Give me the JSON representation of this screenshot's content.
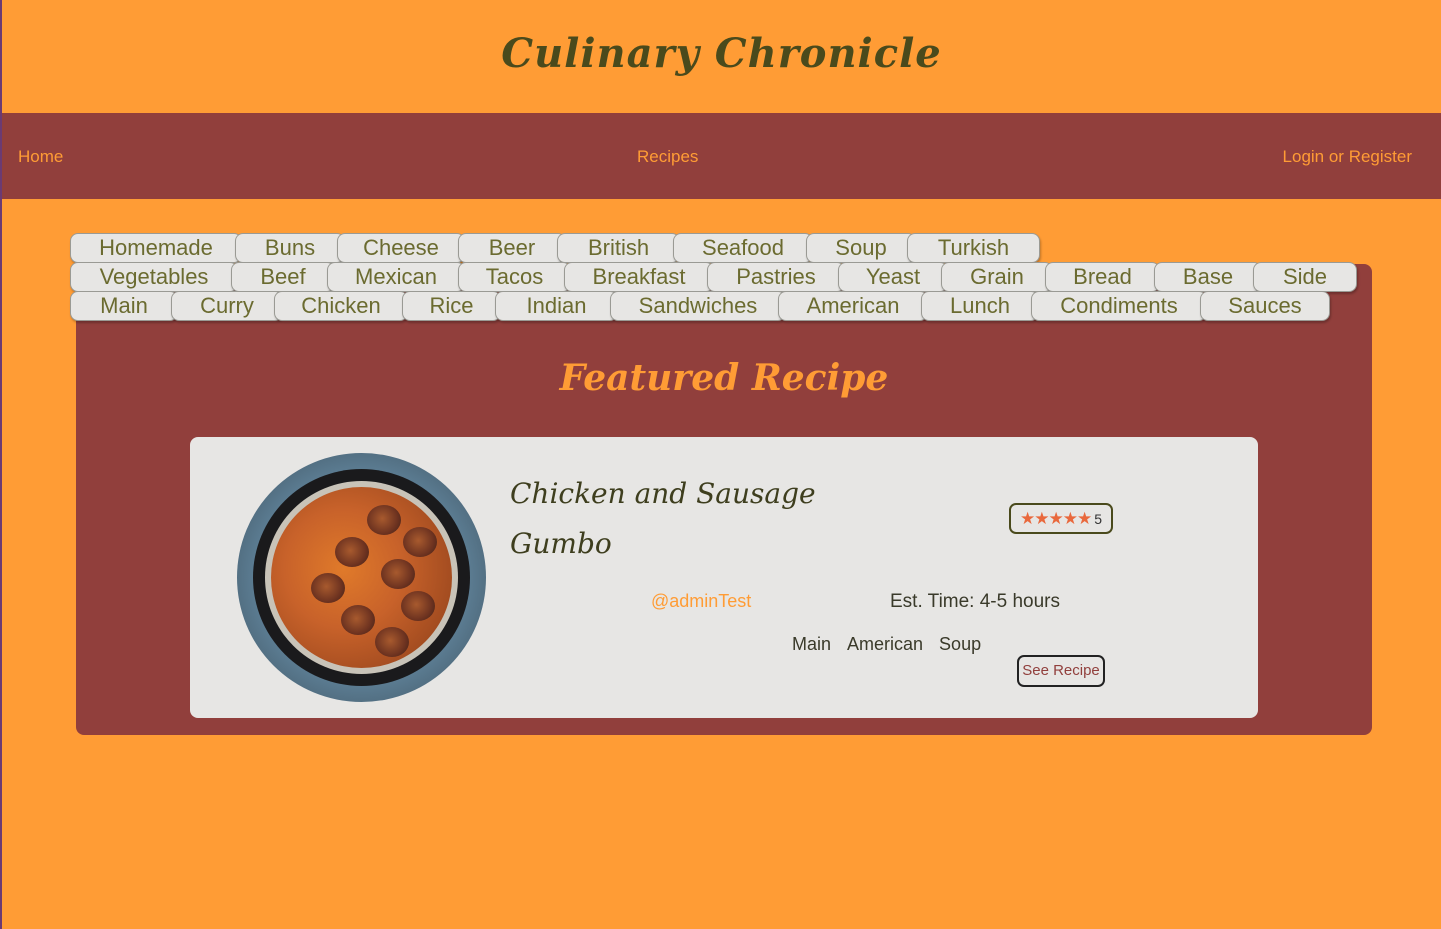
{
  "header": {
    "title": "Culinary Chronicle"
  },
  "nav": {
    "home": "Home",
    "recipes": "Recipes",
    "login": "Login or Register"
  },
  "tags": {
    "row1": [
      "Homemade",
      "Buns",
      "Cheese",
      "Beer",
      "British",
      "Seafood",
      "Soup",
      "Turkish"
    ],
    "row2": [
      "Vegetables",
      "Beef",
      "Mexican",
      "Tacos",
      "Breakfast",
      "Pastries",
      "Yeast",
      "Grain",
      "Bread",
      "Base",
      "Side"
    ],
    "row3": [
      "Main",
      "Curry",
      "Chicken",
      "Rice",
      "Indian",
      "Sandwiches",
      "American",
      "Lunch",
      "Condiments",
      "Sauces"
    ]
  },
  "featured": {
    "heading": "Featured Recipe",
    "title_line1": "Chicken and Sausage",
    "title_line2": "Gumbo",
    "stars": "★★★★★",
    "rating": 5,
    "rating_label": "5",
    "author": "@adminTest",
    "est_time": "Est. Time: 4-5 hours",
    "tags": [
      "Main",
      "American",
      "Soup"
    ],
    "cta": "See Recipe"
  },
  "colors": {
    "background": "#ff9c35",
    "accent_dark": "#913f3c",
    "card": "#e7e6e4",
    "star": "#e9683c"
  }
}
